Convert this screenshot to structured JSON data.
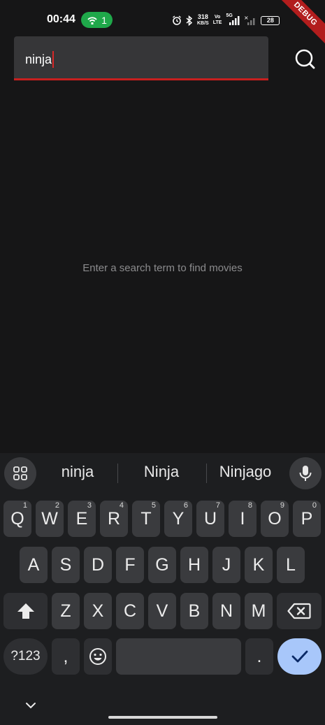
{
  "status_bar": {
    "time": "00:44",
    "hotspot_count": "1",
    "net_speed_value": "318",
    "net_speed_unit": "KB/S",
    "volte_top": "Vo",
    "volte_bottom": "LTE",
    "network_type": "5G",
    "battery": "28",
    "debug_label": "DEBUG"
  },
  "search": {
    "value": "ninja",
    "icon": "search-icon"
  },
  "empty_state": {
    "message": "Enter a search term to find movies"
  },
  "keyboard": {
    "suggestions": [
      "ninja",
      "Ninja",
      "Ninjago"
    ],
    "row1": [
      {
        "label": "Q",
        "hint": "1"
      },
      {
        "label": "W",
        "hint": "2"
      },
      {
        "label": "E",
        "hint": "3"
      },
      {
        "label": "R",
        "hint": "4"
      },
      {
        "label": "T",
        "hint": "5"
      },
      {
        "label": "Y",
        "hint": "6"
      },
      {
        "label": "U",
        "hint": "7"
      },
      {
        "label": "I",
        "hint": "8"
      },
      {
        "label": "O",
        "hint": "9"
      },
      {
        "label": "P",
        "hint": "0"
      }
    ],
    "row2": [
      "A",
      "S",
      "D",
      "F",
      "G",
      "H",
      "J",
      "K",
      "L"
    ],
    "row3": [
      "Z",
      "X",
      "C",
      "V",
      "B",
      "N",
      "M"
    ],
    "symbols_label": "?123",
    "comma_label": ",",
    "period_label": ".",
    "colors": {
      "key": "#3a3b3e",
      "enter": "#a8c7fa",
      "background": "#1d1e20"
    }
  },
  "colors": {
    "accent": "#c81f1f",
    "background": "#161617",
    "field": "#363638"
  }
}
